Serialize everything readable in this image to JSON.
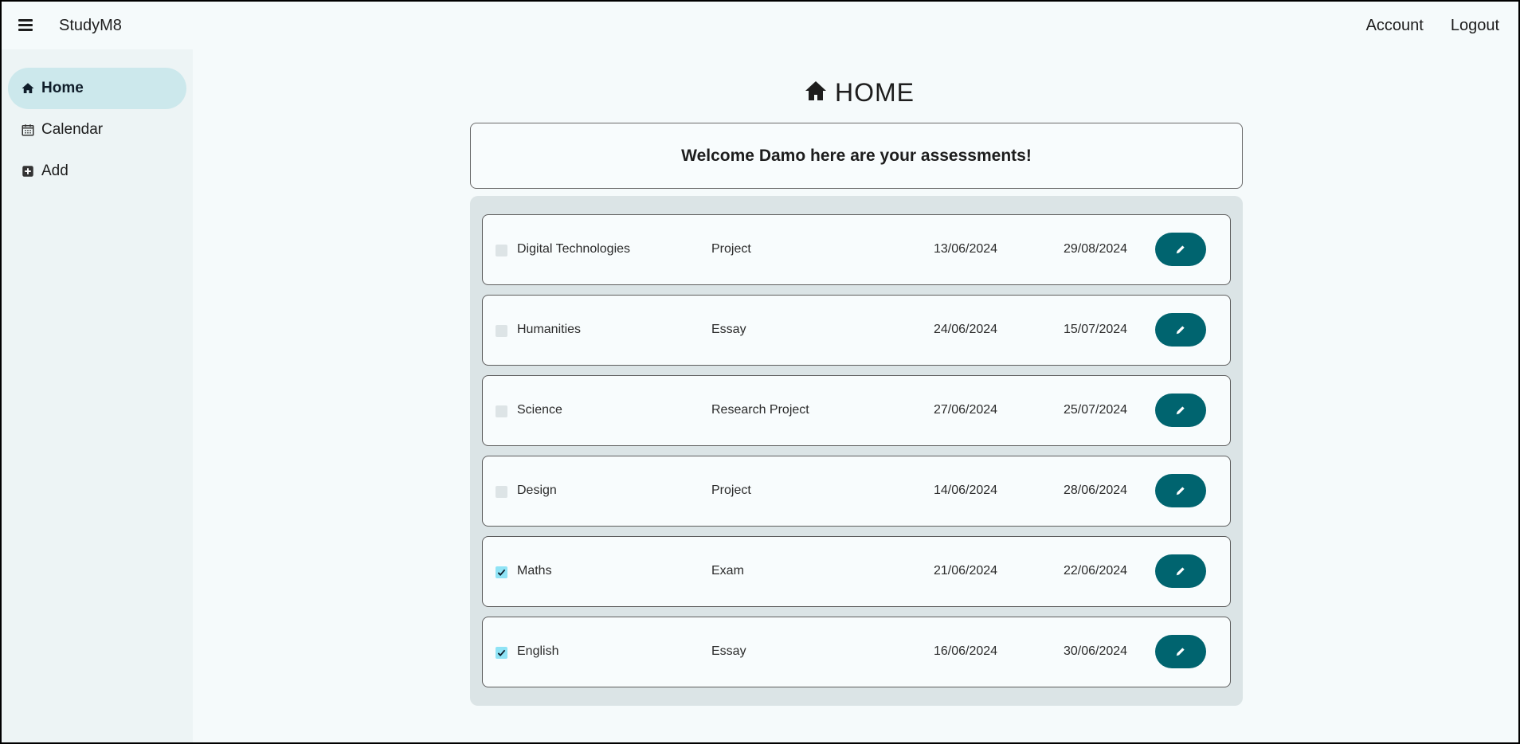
{
  "app": {
    "title": "StudyM8"
  },
  "header": {
    "account_label": "Account",
    "logout_label": "Logout",
    "menu_icon": "hamburger-icon"
  },
  "sidebar": {
    "items": [
      {
        "label": "Home",
        "icon": "home-icon",
        "active": true
      },
      {
        "label": "Calendar",
        "icon": "calendar-icon",
        "active": false
      },
      {
        "label": "Add",
        "icon": "plus-square-icon",
        "active": false
      }
    ]
  },
  "main": {
    "page_title": "HOME",
    "page_icon": "home-icon",
    "welcome": "Welcome Damo here are your assessments!",
    "assessments": [
      {
        "subject": "Digital Technologies",
        "type": "Project",
        "start": "13/06/2024",
        "due": "29/08/2024",
        "done": false
      },
      {
        "subject": "Humanities",
        "type": "Essay",
        "start": "24/06/2024",
        "due": "15/07/2024",
        "done": false
      },
      {
        "subject": "Science",
        "type": "Research Project",
        "start": "27/06/2024",
        "due": "25/07/2024",
        "done": false
      },
      {
        "subject": "Design",
        "type": "Project",
        "start": "14/06/2024",
        "due": "28/06/2024",
        "done": false
      },
      {
        "subject": "Maths",
        "type": "Exam",
        "start": "21/06/2024",
        "due": "22/06/2024",
        "done": true
      },
      {
        "subject": "English",
        "type": "Essay",
        "start": "16/06/2024",
        "due": "30/06/2024",
        "done": true
      }
    ]
  },
  "colors": {
    "accent": "#00646f",
    "active_nav": "#cce8ec",
    "sidebar_bg": "#edf4f5",
    "panel_bg": "#dbe4e6",
    "checked": "#8fe3f5"
  }
}
